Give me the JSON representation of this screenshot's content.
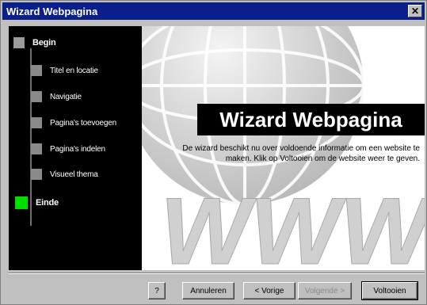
{
  "window": {
    "title": "Wizard Webpagina"
  },
  "steps": [
    {
      "label": "Begin"
    },
    {
      "label": "Titel en locatie"
    },
    {
      "label": "Navigatie"
    },
    {
      "label": "Pagina's toevoegen"
    },
    {
      "label": "Pagina's indelen"
    },
    {
      "label": "Visueel thema"
    },
    {
      "label": "Einde"
    }
  ],
  "hero": {
    "title": "Wizard Webpagina",
    "description": "De wizard beschikt nu over voldoende informatie om een website te maken. Klik op Voltooien om de website weer te geven.",
    "watermark": "WWW"
  },
  "buttons": {
    "help_icon": "?",
    "cancel": "Annuleren",
    "back": "< Vorige",
    "next": "Volgende >",
    "finish": "Voltooien"
  },
  "colors": {
    "titlebar": "#0a1e8c",
    "active_step": "#00e000",
    "step_square": "#8a8a8a"
  }
}
